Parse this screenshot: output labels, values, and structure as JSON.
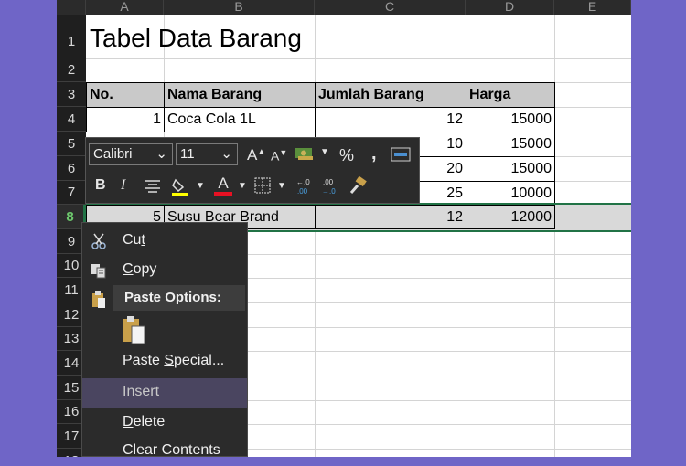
{
  "columns": [
    "A",
    "B",
    "C",
    "D",
    "E"
  ],
  "rows": [
    "1",
    "2",
    "3",
    "4",
    "5",
    "6",
    "7",
    "8",
    "9",
    "10",
    "11",
    "12",
    "13",
    "14",
    "15",
    "16",
    "17",
    "18"
  ],
  "sheet": {
    "title": "Tabel Data Barang",
    "headers": [
      "No.",
      "Nama Barang",
      "Jumlah Barang",
      "Harga"
    ],
    "data": [
      {
        "no": "1",
        "name": "Coca Cola 1L",
        "qty": "12",
        "price": "15000"
      },
      {
        "no": "",
        "name": "",
        "qty": "10",
        "price": "15000"
      },
      {
        "no": "",
        "name": "",
        "qty": "20",
        "price": "15000"
      },
      {
        "no": "",
        "name": "",
        "qty": "25",
        "price": "10000"
      },
      {
        "no": "5",
        "name": "Susu Bear Brand",
        "qty": "12",
        "price": "12000"
      }
    ]
  },
  "mini_toolbar": {
    "font": "Calibri",
    "size": "11",
    "grow_font": "A",
    "shrink_font": "A",
    "percent": "%",
    "comma": ",",
    "bold": "B",
    "italic": "I",
    "font_color_glyph": "A",
    "inc_decimal": ".0\n.00",
    "dec_decimal": ".00\n→.0"
  },
  "context_menu": {
    "items": [
      {
        "label": "Cut",
        "accel": "t",
        "icon": "scissors-icon"
      },
      {
        "label": "Copy",
        "accel": "C",
        "icon": "copy-icon"
      },
      {
        "label": "Paste Options:",
        "icon": "clipboard-icon"
      },
      {
        "label": "Paste Special...",
        "accel": "S"
      },
      {
        "label": "Insert",
        "accel": "I"
      },
      {
        "label": "Delete",
        "accel": "D"
      },
      {
        "label": "Clear Contents",
        "accel": "N"
      }
    ]
  },
  "colors": {
    "selection_accent": "#217346",
    "menu_bg": "#2b2b2b",
    "menu_hover": "#4a4560",
    "page_bg": "#6f65c7"
  }
}
